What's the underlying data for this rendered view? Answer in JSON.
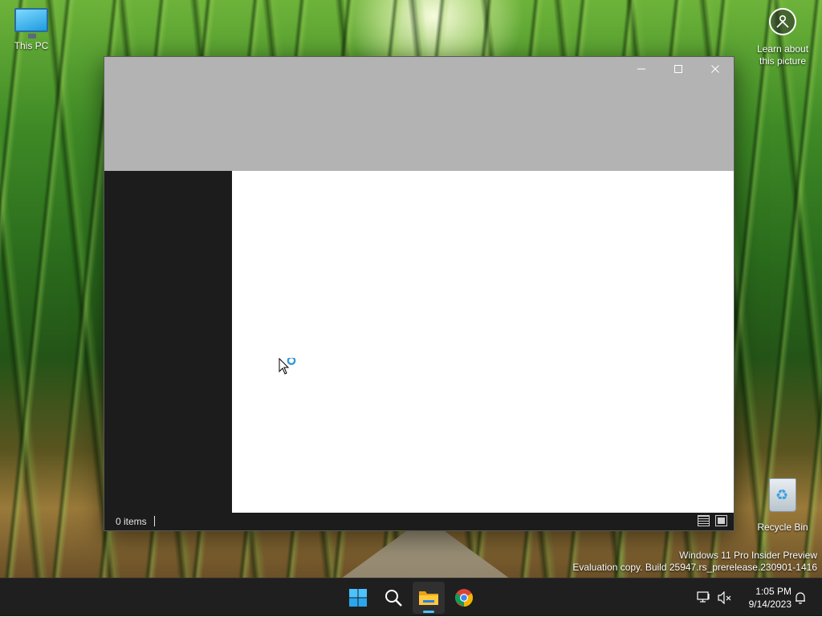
{
  "desktop": {
    "icons": {
      "this_pc": "This PC",
      "learn_line1": "Learn about",
      "learn_line2": "this picture",
      "recycle_bin": "Recycle Bin"
    },
    "watermark": {
      "line1": "Windows 11 Pro Insider Preview",
      "line2": "Evaluation copy. Build 25947.rs_prerelease.230901-1416"
    }
  },
  "window": {
    "buttons": {
      "minimize": "—",
      "maximize": "☐",
      "close": "✕"
    },
    "status": {
      "items": "0 items"
    }
  },
  "taskbar": {
    "clock": {
      "time": "1:05 PM",
      "date": "9/14/2023"
    },
    "apps": [
      "start-icon",
      "search-icon",
      "file-explorer-icon",
      "chrome-icon"
    ],
    "accent": "#4cc2ff"
  }
}
